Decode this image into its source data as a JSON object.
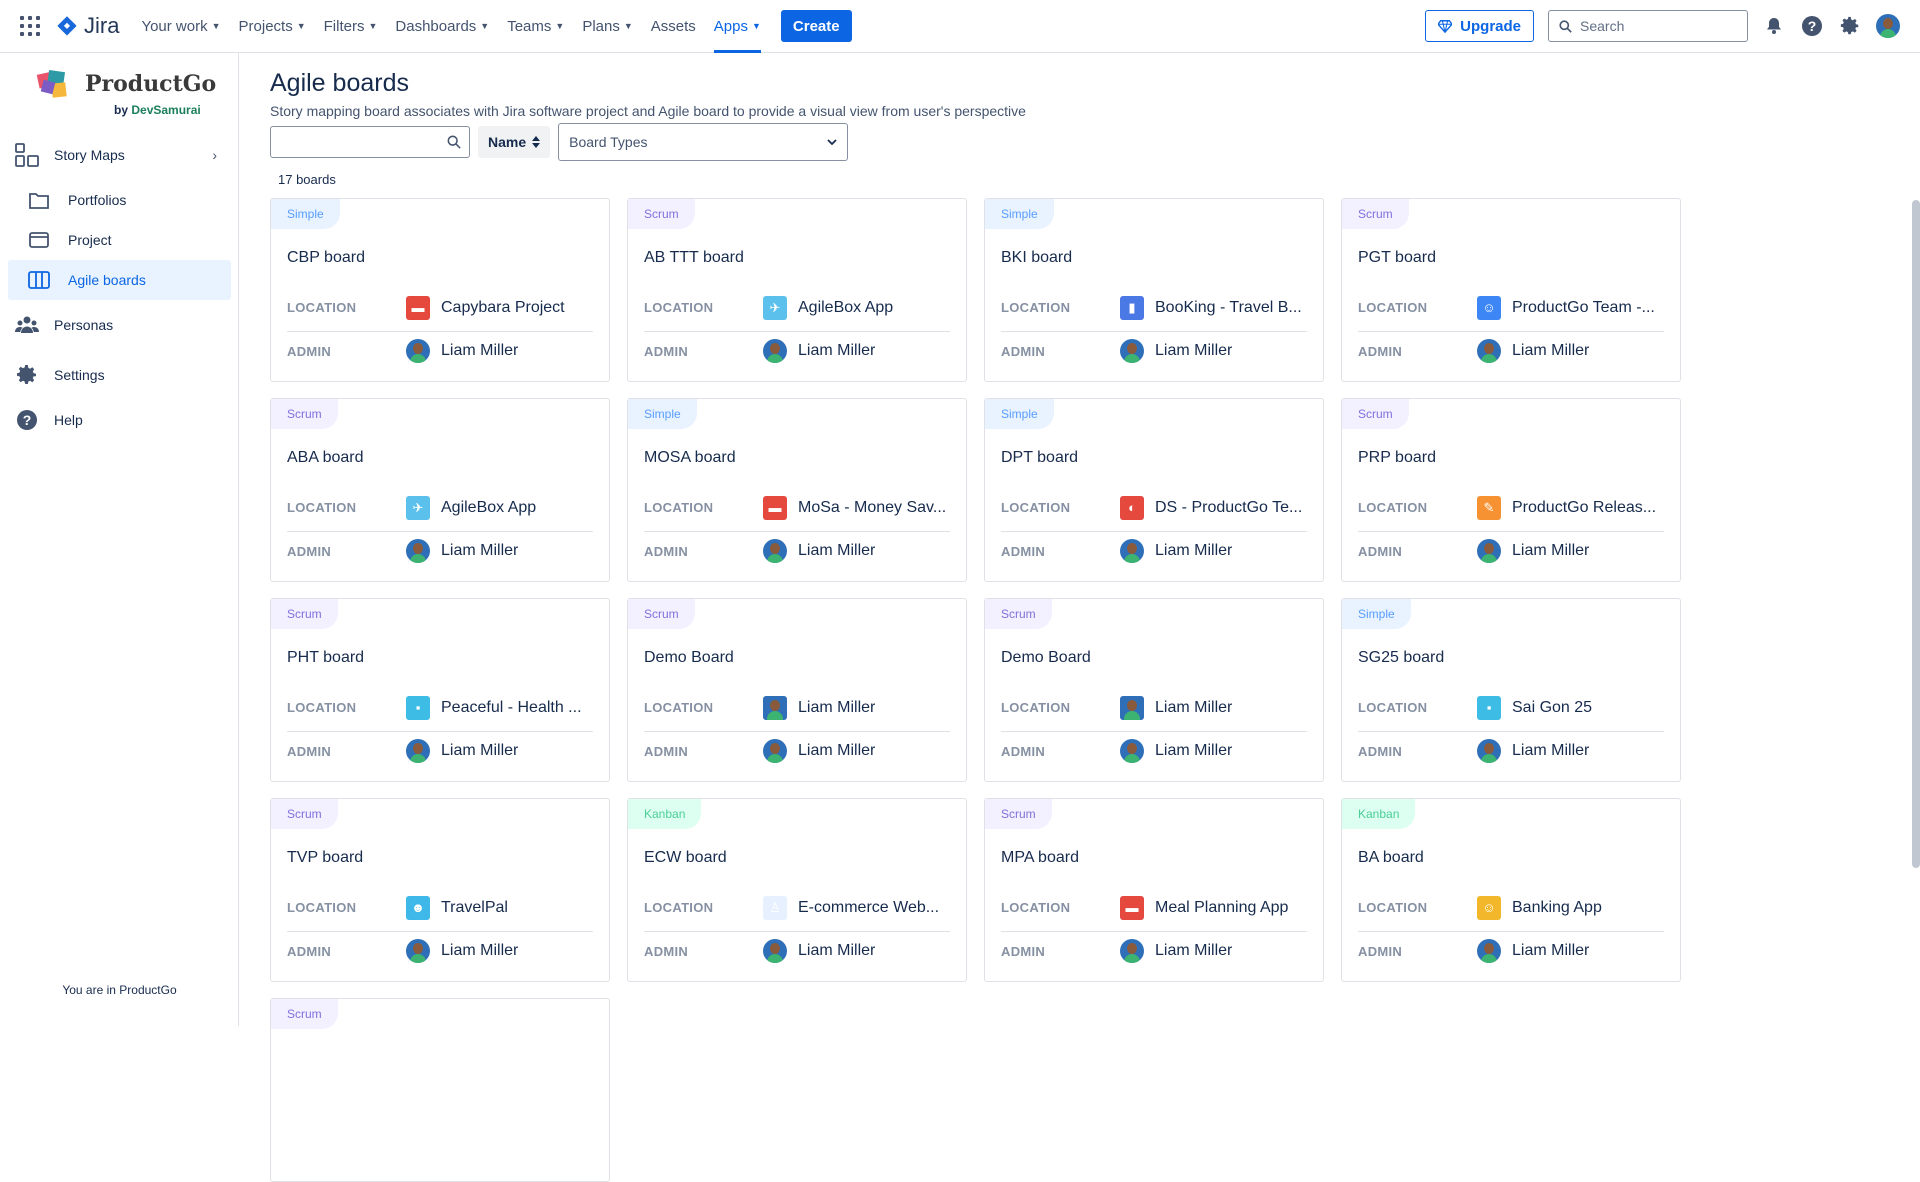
{
  "topnav": {
    "logo_text": "Jira",
    "items": [
      {
        "label": "Your work",
        "dropdown": true
      },
      {
        "label": "Projects",
        "dropdown": true
      },
      {
        "label": "Filters",
        "dropdown": true
      },
      {
        "label": "Dashboards",
        "dropdown": true
      },
      {
        "label": "Teams",
        "dropdown": true
      },
      {
        "label": "Plans",
        "dropdown": true
      },
      {
        "label": "Assets",
        "dropdown": false
      },
      {
        "label": "Apps",
        "dropdown": true,
        "active": true
      }
    ],
    "create_label": "Create",
    "upgrade_label": "Upgrade",
    "search_placeholder": "Search",
    "accent_color": "#0c66e4"
  },
  "sidebar": {
    "brand_name": "ProductGo",
    "brand_by": "by",
    "brand_company": "DevSamurai",
    "items": [
      {
        "label": "Story Maps",
        "icon": "story-maps-icon",
        "expandable": true
      },
      {
        "label": "Portfolios",
        "icon": "folder-icon",
        "sub": true
      },
      {
        "label": "Project",
        "icon": "project-icon",
        "sub": true
      },
      {
        "label": "Agile boards",
        "icon": "board-columns-icon",
        "sub": true,
        "active": true
      },
      {
        "label": "Personas",
        "icon": "people-icon"
      },
      {
        "label": "Settings",
        "icon": "gear-icon"
      },
      {
        "label": "Help",
        "icon": "help-icon"
      }
    ],
    "footer": "You are in ProductGo"
  },
  "main": {
    "title": "Agile boards",
    "description": "Story mapping board associates with Jira software project and Agile board to provide a visual view from user's perspective",
    "search_value": "",
    "sort_label": "Name",
    "type_select_placeholder": "Board Types",
    "count_label": "17 boards",
    "location_label": "LOCATION",
    "admin_label": "ADMIN",
    "boards": [
      {
        "type": "Simple",
        "name": "CBP board",
        "location": "Capybara Project",
        "loc_icon": "capybara-project-icon",
        "admin": "Liam Miller"
      },
      {
        "type": "Scrum",
        "name": "AB TTT board",
        "location": "AgileBox App",
        "loc_icon": "agilebox-app-icon",
        "admin": "Liam Miller"
      },
      {
        "type": "Simple",
        "name": "BKI board",
        "location": "BooKing - Travel B...",
        "loc_icon": "booking-icon",
        "admin": "Liam Miller"
      },
      {
        "type": "Scrum",
        "name": "PGT board",
        "location": "ProductGo Team -...",
        "loc_icon": "productgo-team-icon",
        "admin": "Liam Miller"
      },
      {
        "type": "Scrum",
        "name": "ABA board",
        "location": "AgileBox App",
        "loc_icon": "agilebox-app-icon",
        "admin": "Liam Miller"
      },
      {
        "type": "Simple",
        "name": "MOSA board",
        "location": "MoSa - Money Sav...",
        "loc_icon": "mosa-icon",
        "admin": "Liam Miller"
      },
      {
        "type": "Simple",
        "name": "DPT board",
        "location": "DS - ProductGo Te...",
        "loc_icon": "ds-productgo-icon",
        "admin": "Liam Miller"
      },
      {
        "type": "Scrum",
        "name": "PRP board",
        "location": "ProductGo Releas...",
        "loc_icon": "productgo-release-icon",
        "admin": "Liam Miller"
      },
      {
        "type": "Scrum",
        "name": "PHT board",
        "location": "Peaceful - Health ...",
        "loc_icon": "peaceful-health-icon",
        "admin": "Liam Miller"
      },
      {
        "type": "Scrum",
        "name": "Demo Board",
        "location": "Liam Miller",
        "loc_icon": "user-location-icon",
        "admin": "Liam Miller"
      },
      {
        "type": "Scrum",
        "name": "Demo Board",
        "location": "Liam Miller",
        "loc_icon": "user-location-icon",
        "admin": "Liam Miller"
      },
      {
        "type": "Simple",
        "name": "SG25 board",
        "location": "Sai Gon 25",
        "loc_icon": "sai-gon-icon",
        "admin": "Liam Miller"
      },
      {
        "type": "Scrum",
        "name": "TVP board",
        "location": "TravelPal",
        "loc_icon": "travelpal-icon",
        "admin": "Liam Miller"
      },
      {
        "type": "Kanban",
        "name": "ECW board",
        "location": "E-commerce Web...",
        "loc_icon": "ecommerce-icon",
        "admin": "Liam Miller"
      },
      {
        "type": "Scrum",
        "name": "MPA board",
        "location": "Meal Planning App",
        "loc_icon": "meal-planning-icon",
        "admin": "Liam Miller"
      },
      {
        "type": "Kanban",
        "name": "BA board",
        "location": "Banking App",
        "loc_icon": "banking-app-icon",
        "admin": "Liam Miller"
      },
      {
        "type": "Scrum",
        "name": "",
        "location": "",
        "loc_icon": "",
        "admin": ""
      }
    ]
  }
}
